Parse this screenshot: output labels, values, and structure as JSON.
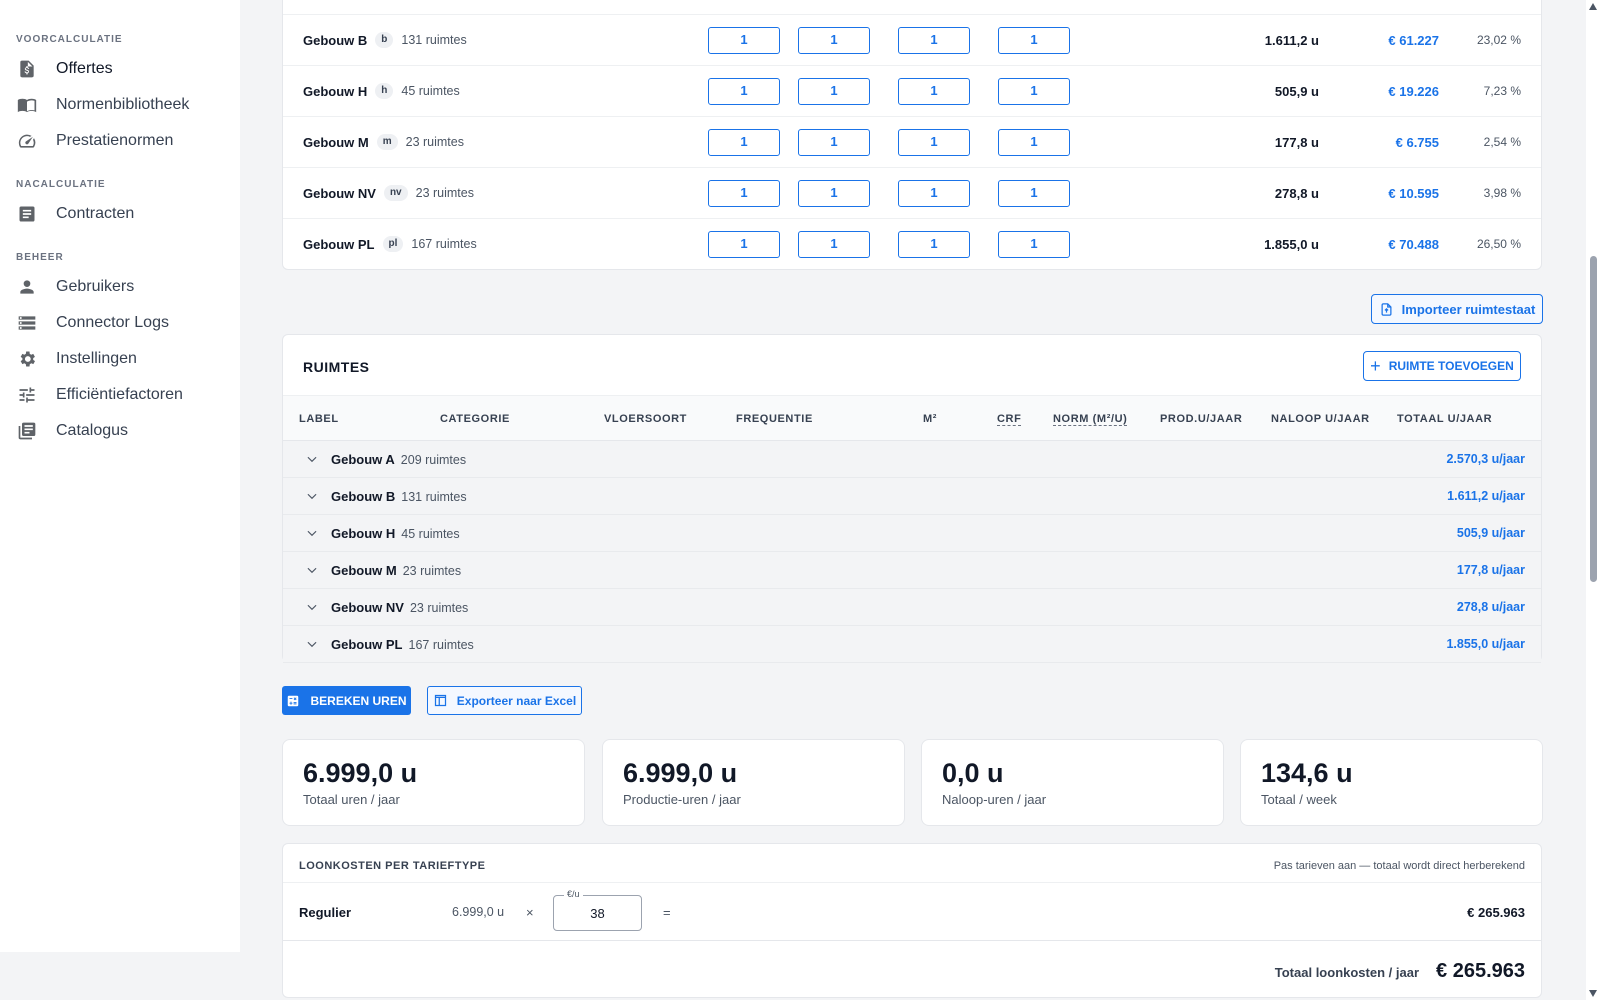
{
  "sidebar": {
    "sections": [
      {
        "title": "VOORCALCULATIE",
        "items": [
          {
            "label": "Offertes",
            "icon": "quote-document-icon"
          },
          {
            "label": "Normenbibliotheek",
            "icon": "book-icon"
          },
          {
            "label": "Prestatienormen",
            "icon": "speedometer-icon"
          }
        ]
      },
      {
        "title": "NACALCULATIE",
        "items": [
          {
            "label": "Contracten",
            "icon": "document-icon"
          }
        ]
      },
      {
        "title": "BEHEER",
        "items": [
          {
            "label": "Gebruikers",
            "icon": "person-icon"
          },
          {
            "label": "Connector Logs",
            "icon": "list-icon"
          },
          {
            "label": "Instellingen",
            "icon": "gear-icon"
          },
          {
            "label": "Efficiëntiefactoren",
            "icon": "sliders-icon"
          },
          {
            "label": "Catalogus",
            "icon": "library-icon"
          }
        ]
      }
    ]
  },
  "buildings": [
    {
      "name": "Gebouw B",
      "code": "b",
      "rooms": "131 ruimtes",
      "inputs": [
        "1",
        "1",
        "1",
        "1"
      ],
      "hours": "1.611,2 u",
      "cost": "€ 61.227",
      "pct": "23,02 %"
    },
    {
      "name": "Gebouw H",
      "code": "h",
      "rooms": "45 ruimtes",
      "inputs": [
        "1",
        "1",
        "1",
        "1"
      ],
      "hours": "505,9 u",
      "cost": "€ 19.226",
      "pct": "7,23 %"
    },
    {
      "name": "Gebouw M",
      "code": "m",
      "rooms": "23 ruimtes",
      "inputs": [
        "1",
        "1",
        "1",
        "1"
      ],
      "hours": "177,8 u",
      "cost": "€ 6.755",
      "pct": "2,54 %"
    },
    {
      "name": "Gebouw NV",
      "code": "nv",
      "rooms": "23 ruimtes",
      "inputs": [
        "1",
        "1",
        "1",
        "1"
      ],
      "hours": "278,8 u",
      "cost": "€ 10.595",
      "pct": "3,98 %"
    },
    {
      "name": "Gebouw PL",
      "code": "pl",
      "rooms": "167 ruimtes",
      "inputs": [
        "1",
        "1",
        "1",
        "1"
      ],
      "hours": "1.855,0 u",
      "cost": "€ 70.488",
      "pct": "26,50 %"
    }
  ],
  "import_button": "Importeer ruimtestaat",
  "rooms": {
    "title": "RUIMTES",
    "add_button": "RUIMTE TOEVOEGEN",
    "columns": [
      "LABEL",
      "CATEGORIE",
      "VLOERSOORT",
      "FREQUENTIE",
      "M²",
      "CRF",
      "NORM (M²/U)",
      "PROD.U/JAAR",
      "NALOOP U/JAAR",
      "TOTAAL U/JAAR"
    ],
    "groups": [
      {
        "name": "Gebouw A",
        "count": "209 ruimtes",
        "total": "2.570,3 u/jaar"
      },
      {
        "name": "Gebouw B",
        "count": "131 ruimtes",
        "total": "1.611,2 u/jaar"
      },
      {
        "name": "Gebouw H",
        "count": "45 ruimtes",
        "total": "505,9 u/jaar"
      },
      {
        "name": "Gebouw M",
        "count": "23 ruimtes",
        "total": "177,8 u/jaar"
      },
      {
        "name": "Gebouw NV",
        "count": "23 ruimtes",
        "total": "278,8 u/jaar"
      },
      {
        "name": "Gebouw PL",
        "count": "167 ruimtes",
        "total": "1.855,0 u/jaar"
      }
    ]
  },
  "actions": {
    "calculate": "BEREKEN UREN",
    "export": "Exporteer naar Excel"
  },
  "stats": [
    {
      "value": "6.999,0 u",
      "label": "Totaal uren / jaar"
    },
    {
      "value": "6.999,0 u",
      "label": "Productie-uren / jaar"
    },
    {
      "value": "0,0 u",
      "label": "Naloop-uren / jaar"
    },
    {
      "value": "134,6 u",
      "label": "Totaal / week"
    }
  ],
  "wage": {
    "title": "LOONKOSTEN PER TARIEFTYPE",
    "note": "Pas tarieven aan — totaal wordt direct herberekend",
    "rows": [
      {
        "type": "Regulier",
        "hours": "6.999,0 u",
        "times": "×",
        "rate_legend": "€/u",
        "rate": "38",
        "equals": "=",
        "sum": "€ 265.963"
      }
    ],
    "total_label": "Totaal loonkosten / jaar",
    "total_value": "€ 265.963"
  },
  "colors": {
    "accent": "#1a73e8",
    "background": "#f3f4f6"
  }
}
